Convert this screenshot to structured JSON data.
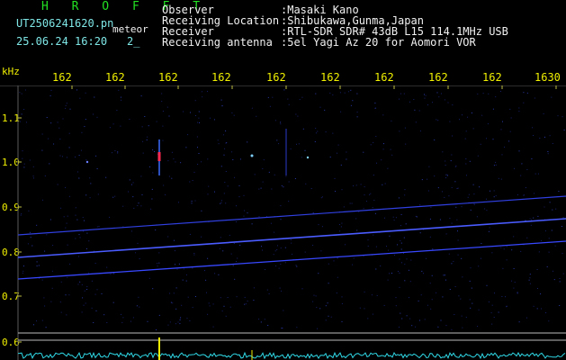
{
  "header": {
    "program": "H R O F F T",
    "filename": "UT2506241620.pn",
    "tag": "meteor",
    "datetime": "25.06.24 16:20",
    "count": "2_",
    "info": [
      {
        "label": "Observer",
        "value": ":Masaki Kano"
      },
      {
        "label": "Receiving Location",
        "value": ":Shibukawa,Gunma,Japan"
      },
      {
        "label": "Receiver",
        "value": ":RTL-SDR SDR# 43dB L15 114.1MHz USB"
      },
      {
        "label": "Receiving antenna",
        "value": ":5el Yagi Az 20 for Aomori VOR"
      }
    ]
  },
  "axis": {
    "y_unit": "kHz",
    "x_ticks": [
      "162",
      "162",
      "162",
      "162",
      "162",
      "162",
      "162",
      "162",
      "162",
      "1630"
    ],
    "y_ticks": [
      "1.1",
      "1.0",
      "0.9",
      "0.8",
      "0.7",
      "0.6"
    ]
  },
  "colors": {
    "header_text": "#22e022",
    "tick_text": "#f0f000",
    "info_text": "#f2f2f2",
    "trace": "#3a4cff",
    "noise": "#1e2a88",
    "spectrum": "#2fd8e6",
    "echo": "#ff2a50",
    "burst": "#f0f000"
  }
}
